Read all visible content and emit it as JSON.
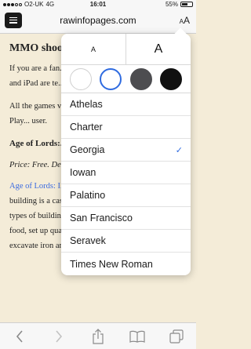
{
  "status_bar": {
    "carrier": "O2-UK",
    "network": "4G",
    "time": "16:01",
    "battery": "55%"
  },
  "url_bar": {
    "url": "rawinfopages.com",
    "text_size_label_small": "A",
    "text_size_label_large": "A"
  },
  "article": {
    "headline": "MMO shoo... games bat...",
    "p1": "If you are a fan... online games)... popular genre... and iPad are te... losers.",
    "p2": "All the games v... also work on an... the Google Play... user.",
    "h2": "Age of Lords:...",
    "price": "Price: Free. De...",
    "link": "Age of Lords: I...",
    "p3_tail": "middle ages and your main building is a castle. Around it is space for many other types of building and you must place farms for grow food, set up quarries to get rock, iron mines to excavate iron and more."
  },
  "popover": {
    "size_small": "A",
    "size_large": "A",
    "themes": [
      {
        "name": "white",
        "color": "#ffffff",
        "selected": false
      },
      {
        "name": "sepia",
        "color": "#ffffff",
        "selected": true
      },
      {
        "name": "gray",
        "color": "#4d4d50",
        "selected": false
      },
      {
        "name": "night",
        "color": "#111111",
        "selected": false
      }
    ],
    "fonts": [
      {
        "label": "Athelas",
        "selected": false
      },
      {
        "label": "Charter",
        "selected": false
      },
      {
        "label": "Georgia",
        "selected": true
      },
      {
        "label": "Iowan",
        "selected": false
      },
      {
        "label": "Palatino",
        "selected": false
      },
      {
        "label": "San Francisco",
        "selected": false
      },
      {
        "label": "Seravek",
        "selected": false
      },
      {
        "label": "Times New Roman",
        "selected": false
      }
    ],
    "check_mark": "✓"
  },
  "toolbar": {
    "icons": [
      "back-icon",
      "forward-icon",
      "share-icon",
      "bookmarks-icon",
      "tabs-icon"
    ]
  }
}
